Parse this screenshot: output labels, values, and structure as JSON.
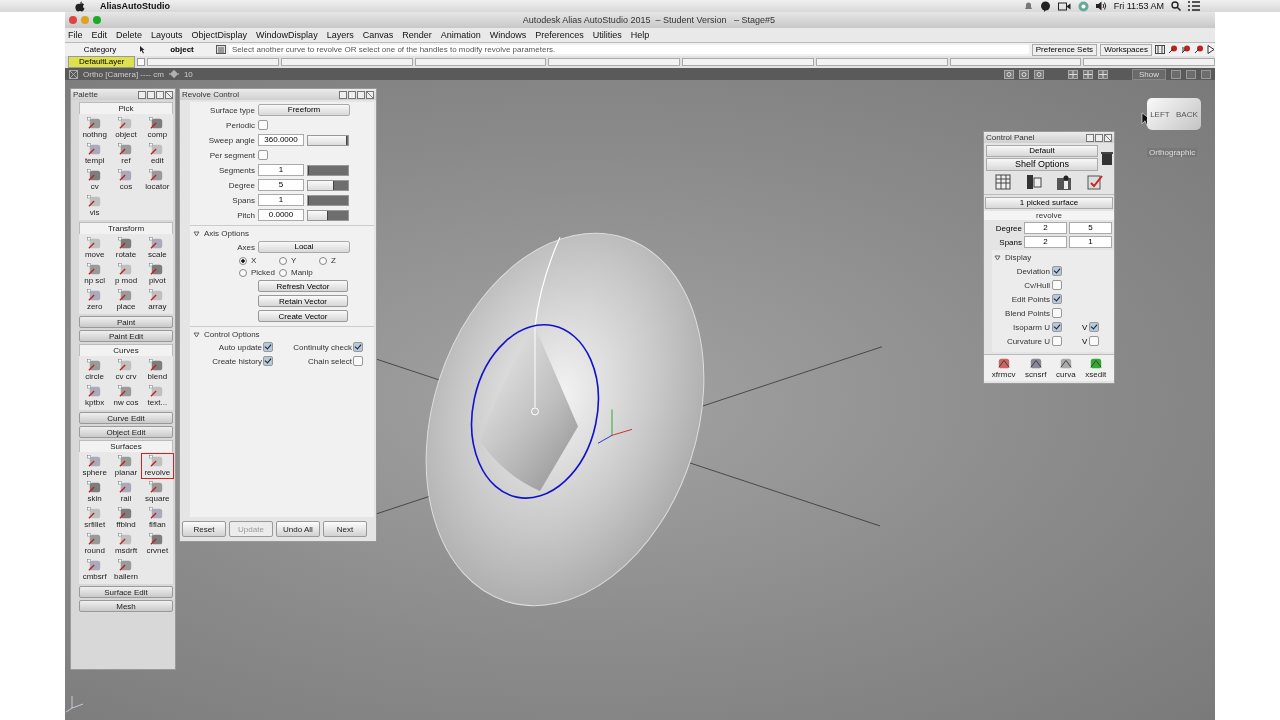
{
  "mac_menubar": {
    "app": "AliasAutoStudio",
    "clock": "Fri 11:53 AM"
  },
  "window": {
    "title": "Autodesk Alias AutoStudio 2015  – Student Version   – Stage#5"
  },
  "menu": [
    "File",
    "Edit",
    "Delete",
    "Layouts",
    "ObjectDisplay",
    "WindowDisplay",
    "Layers",
    "Canvas",
    "Render",
    "Animation",
    "Windows",
    "Preferences",
    "Utilities",
    "Help"
  ],
  "prompt": {
    "category": "Category",
    "pick_mode": "object",
    "message": "Select another curve to revolve OR select one of the handles to modify revolve parameters.",
    "buttons": [
      "Preference Sets",
      "Workspaces"
    ]
  },
  "layers": [
    {
      "label": "DefaultLayer",
      "selected": true,
      "checked": false
    }
  ],
  "viewport": {
    "camera": "Ortho [Camera] ---- cm",
    "grid": "10",
    "show": "Show",
    "view_label": "Orthographic",
    "cube_faces": [
      "LEFT",
      "BACK"
    ]
  },
  "palette": {
    "title": "Palette",
    "sections": [
      {
        "label": "Pick",
        "expanded": true,
        "tools": [
          {
            "label": "nothng",
            "selected": false
          },
          {
            "label": "object",
            "selected": false
          },
          {
            "label": "comp",
            "selected": false
          },
          {
            "label": "templ",
            "selected": false
          },
          {
            "label": "ref",
            "selected": false
          },
          {
            "label": "edit",
            "selected": false
          },
          {
            "label": "cv",
            "selected": false
          },
          {
            "label": "cos",
            "selected": false
          },
          {
            "label": "locator",
            "selected": false
          },
          {
            "label": "vis",
            "selected": false
          }
        ]
      },
      {
        "label": "Transform",
        "expanded": true,
        "tools": [
          {
            "label": "move",
            "selected": false
          },
          {
            "label": "rotate",
            "selected": false
          },
          {
            "label": "scale",
            "selected": false
          },
          {
            "label": "np scl",
            "selected": false
          },
          {
            "label": "p mod",
            "selected": false
          },
          {
            "label": "pivot",
            "selected": false
          },
          {
            "label": "zero",
            "selected": false
          },
          {
            "label": "place",
            "selected": false
          },
          {
            "label": "array",
            "selected": false
          }
        ]
      },
      {
        "label": "Paint",
        "expanded": false
      },
      {
        "label": "Paint Edit",
        "expanded": false
      },
      {
        "label": "Curves",
        "expanded": true,
        "tools": [
          {
            "label": "circle",
            "selected": false
          },
          {
            "label": "cv crv",
            "selected": false
          },
          {
            "label": "blend",
            "selected": false
          },
          {
            "label": "kptbx",
            "selected": false
          },
          {
            "label": "nw cos",
            "selected": false
          },
          {
            "label": "text...",
            "selected": false
          }
        ]
      },
      {
        "label": "Curve Edit",
        "expanded": false
      },
      {
        "label": "Object Edit",
        "expanded": false
      },
      {
        "label": "Surfaces",
        "expanded": true,
        "tools": [
          {
            "label": "sphere",
            "selected": false
          },
          {
            "label": "planar",
            "selected": false
          },
          {
            "label": "revolve",
            "selected": true
          },
          {
            "label": "skin",
            "selected": false
          },
          {
            "label": "rail",
            "selected": false
          },
          {
            "label": "square",
            "selected": false
          },
          {
            "label": "srfillet",
            "selected": false
          },
          {
            "label": "ffblnd",
            "selected": false
          },
          {
            "label": "flflan",
            "selected": false
          },
          {
            "label": "round",
            "selected": false
          },
          {
            "label": "msdrft",
            "selected": false
          },
          {
            "label": "crvnet",
            "selected": false
          },
          {
            "label": "cmbsrf",
            "selected": false
          },
          {
            "label": "ballern",
            "selected": false
          }
        ]
      },
      {
        "label": "Surface Edit",
        "expanded": false
      },
      {
        "label": "Mesh",
        "expanded": false
      }
    ]
  },
  "revolve": {
    "title": "Revolve Control",
    "fields": [
      {
        "kind": "dropdown",
        "label": "Surface type",
        "value": "Freeform"
      },
      {
        "kind": "checkbox",
        "label": "Periodic",
        "checked": false
      },
      {
        "kind": "slider",
        "label": "Sweep angle",
        "value": "360.0000",
        "level": 0.97
      },
      {
        "kind": "checkbox",
        "label": "Per segment",
        "checked": false
      },
      {
        "kind": "slider",
        "label": "Segments",
        "value": "1",
        "level": 0.03
      },
      {
        "kind": "slider",
        "label": "Degree",
        "value": "5",
        "level": 0.65
      },
      {
        "kind": "slider",
        "label": "Spans",
        "value": "1",
        "level": 0.03
      },
      {
        "kind": "slider",
        "label": "Pitch",
        "value": "0.0000",
        "level": 0.5
      }
    ],
    "axis": {
      "title": "Axis Options",
      "expanded": true,
      "axes_label": "Axes",
      "axes": "Local",
      "radios": [
        {
          "label": "X",
          "selected": true
        },
        {
          "label": "Y",
          "selected": false
        },
        {
          "label": "Z",
          "selected": false
        },
        {
          "label": "Picked",
          "selected": false
        },
        {
          "label": "Manip",
          "selected": false
        }
      ],
      "buttons": [
        "Refresh Vector",
        "Retain Vector",
        "Create Vector"
      ]
    },
    "control": {
      "title": "Control Options",
      "expanded": true,
      "checks": [
        {
          "label": "Auto update",
          "checked": true
        },
        {
          "label": "Continuity check",
          "checked": true
        },
        {
          "label": "Create history",
          "checked": true
        },
        {
          "label": "Chain select",
          "checked": false
        }
      ]
    },
    "footer": [
      {
        "label": "Reset",
        "disabled": false
      },
      {
        "label": "Update",
        "disabled": true
      },
      {
        "label": "Undo All",
        "disabled": false
      },
      {
        "label": "Next",
        "disabled": false
      }
    ]
  },
  "control_panel": {
    "title": "Control Panel",
    "preset": "Default",
    "shelf": "Shelf Options",
    "picked": "1 picked surface",
    "object": "revolve",
    "grid": [
      {
        "label": "Degree",
        "u": "2",
        "v": "5"
      },
      {
        "label": "Spans",
        "u": "2",
        "v": "1"
      }
    ],
    "display": {
      "title": "Display",
      "expanded": true,
      "rows": [
        {
          "label": "Deviation",
          "checked": true
        },
        {
          "label": "Cv/Hull",
          "checked": false
        },
        {
          "label": "Edit Points",
          "checked": true
        },
        {
          "label": "Blend Points",
          "checked": false
        },
        {
          "label": "Isoparm U",
          "checked": true,
          "v_label": "V",
          "v_checked": true
        },
        {
          "label": "Curvature U",
          "checked": false,
          "v_label": "V",
          "v_checked": false
        }
      ]
    },
    "shelf_tools": [
      "xfrmcv",
      "scnsrf",
      "curva",
      "xsedit"
    ]
  }
}
